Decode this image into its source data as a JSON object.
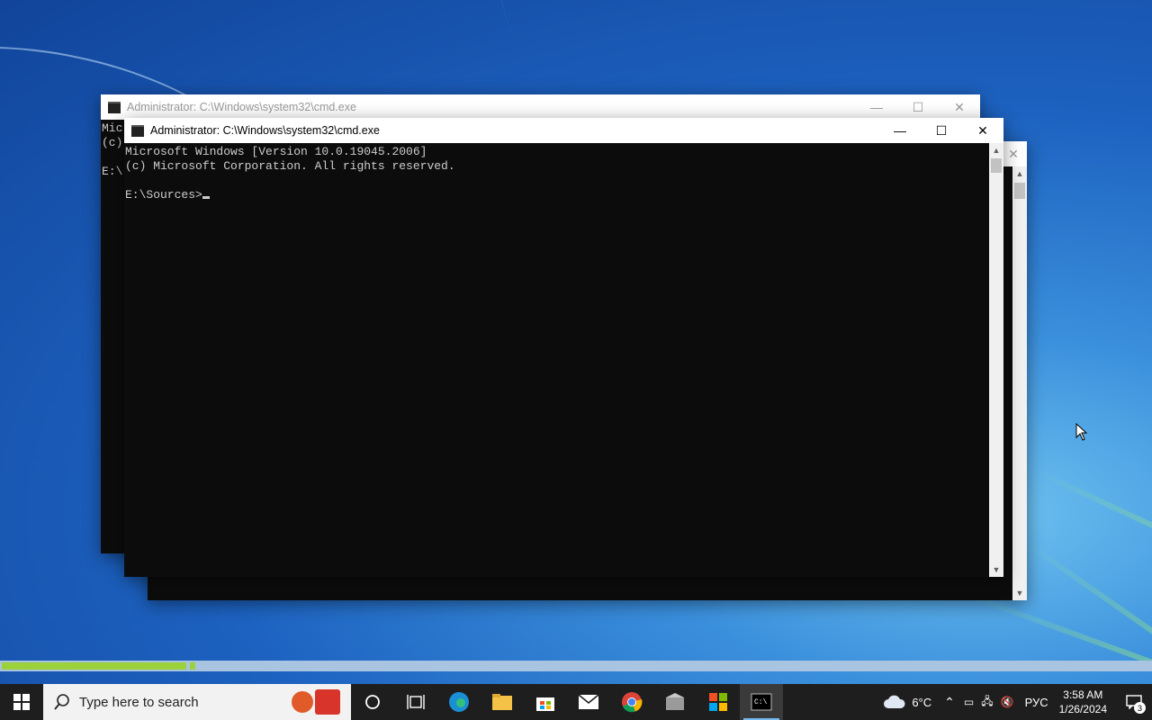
{
  "window_back": {
    "title": "Administrator: C:\\Windows\\system32\\cmd.exe",
    "console_fragments": [
      "Mic",
      "(c)",
      "",
      "E:\\"
    ]
  },
  "window_front": {
    "title": "Administrator: C:\\Windows\\system32\\cmd.exe",
    "console_lines": [
      "Microsoft Windows [Version 10.0.19045.2006]",
      "(c) Microsoft Corporation. All rights reserved.",
      "",
      "E:\\Sources>"
    ],
    "minimize_glyph": "—",
    "maximize_glyph": "☐",
    "close_glyph": "✕"
  },
  "progress": {
    "fill_fraction": 0.16
  },
  "taskbar": {
    "search_placeholder": "Type here to search",
    "weather": "6°C",
    "language": "РУС",
    "time": "3:58 AM",
    "date": "1/26/2024",
    "notification_count": "3",
    "icons": [
      "windows-start-icon",
      "search-icon",
      "cortana-circle-icon",
      "task-view-icon",
      "edge-icon",
      "file-explorer-icon",
      "store-icon",
      "mail-icon",
      "chrome-icon",
      "package-icon",
      "windows-flag-icon",
      "cmd-icon"
    ]
  },
  "colors": {
    "accent": "#76b9ed",
    "progress": "#9bd13a",
    "console_bg": "#0c0c0c",
    "console_fg": "#cccccc"
  }
}
